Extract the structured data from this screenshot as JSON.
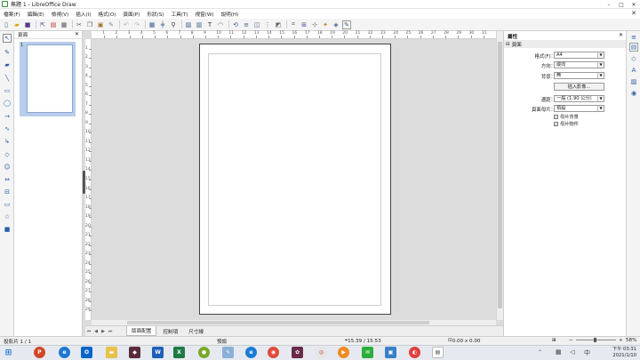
{
  "window": {
    "title": "無題 1 - LibreOffice Draw",
    "controls": [
      "–",
      "□",
      "✕"
    ]
  },
  "menu": [
    "檔案(F)",
    "編輯(E)",
    "檢視(V)",
    "插入(I)",
    "格式(O)",
    "頁面(P)",
    "形狀(S)",
    "工具(T)",
    "視窗(W)",
    "說明(H)"
  ],
  "toolbar": {
    "icons": [
      "new-icon",
      "open-icon",
      "save-icon",
      "export-icon",
      "export-pdf-icon",
      "print-icon",
      "cut-icon",
      "copy-icon",
      "paste-icon",
      "clone-icon",
      "undo-icon",
      "redo-icon",
      "grid-icon",
      "helplines-icon",
      "zoom-icon",
      "image-icon",
      "chart-icon",
      "textbox-icon",
      "fontwork-icon",
      "transform-icon",
      "align-icon",
      "arrange-icon",
      "distribute-icon",
      "shadow-icon",
      "crop-icon",
      "filter-icon",
      "points-icon",
      "gluepoints-icon",
      "toggle-extrusion-icon",
      "draw-functions-icon"
    ]
  },
  "pages_panel": {
    "title": "頁面",
    "thumb_number": "1"
  },
  "ruler": {
    "h_labels": [
      "1",
      "2",
      "3",
      "4",
      "5",
      "6",
      "7",
      "8",
      "9",
      "10",
      "11",
      "12",
      "13",
      "14",
      "15",
      "16",
      "17",
      "18",
      "19",
      "20",
      "21",
      "22",
      "23",
      "24",
      "25",
      "26",
      "27",
      "28",
      "29",
      "30",
      "31"
    ],
    "v_labels": [
      "1",
      "2",
      "3",
      "4",
      "5",
      "6",
      "7",
      "8",
      "9",
      "10",
      "11",
      "12",
      "13",
      "14",
      "15",
      "16",
      "17",
      "18",
      "19",
      "20",
      "21",
      "22",
      "23",
      "24",
      "25",
      "26",
      "27",
      "28",
      "29"
    ]
  },
  "tabs": [
    "版面配置",
    "控制項",
    "尺寸線"
  ],
  "sidebar": {
    "title": "屬性",
    "section": "頁面",
    "format_label": "格式(F)：",
    "format_value": "A4",
    "orientation_label": "方向：",
    "orientation_value": "縱向",
    "background_label": "背景：",
    "background_value": "無",
    "insert_image_label": "插入影像...",
    "margins_label": "邊距：",
    "margins_value": "一般 (1.90 公分)",
    "master_label": "頁面母片：",
    "master_value": "預設",
    "master_bg_label": "母片背景",
    "master_obj_label": "母片物件"
  },
  "status": {
    "page": "投影片 1 / 1",
    "master": "預設",
    "position": "15.39 / 15.53",
    "size": "0.00 x 0.00",
    "zoom": "58%"
  },
  "taskbar": {
    "time": "下午 03:31",
    "date": "2021/1/10"
  },
  "colors": {
    "accent": "#2a5ea8",
    "thumb_selected": "#b7cdea"
  }
}
